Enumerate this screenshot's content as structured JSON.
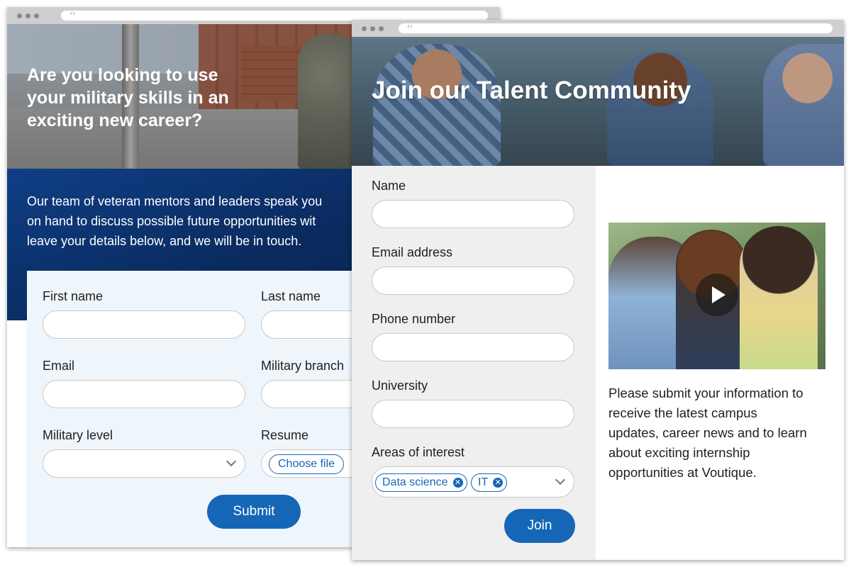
{
  "military_page": {
    "hero_heading_lines": [
      "Are you looking to use",
      "your military skills in an",
      "exciting new career?"
    ],
    "intro_lines": [
      "Our team of veteran mentors and leaders speak you",
      "on hand to discuss possible future opportunities wit",
      "leave your details below, and we will be in touch."
    ],
    "form": {
      "first_name_label": "First name",
      "last_name_label": "Last name",
      "email_label": "Email",
      "military_branch_label": "Military branch",
      "military_level_label": "Military level",
      "resume_label": "Resume",
      "choose_file_label": "Choose file",
      "submit_label": "Submit"
    }
  },
  "talent_page": {
    "hero_heading": "Join our Talent Community",
    "form": {
      "name_label": "Name",
      "email_label": "Email address",
      "phone_label": "Phone number",
      "university_label": "University",
      "interests_label": "Areas of interest",
      "interest_chips": [
        "Data science",
        "IT"
      ],
      "join_label": "Join"
    },
    "description_lines": [
      "Please submit your information to",
      "receive the latest campus",
      "updates, career news and to learn",
      "about exciting internship",
      "opportunities at Voutique."
    ]
  },
  "colors": {
    "accent_blue": "#1666b8",
    "navy_band": "#0a2a5e",
    "form_bg_light_blue": "#eef5fb",
    "form_bg_gray": "#efefef"
  },
  "icons": [
    "chevron-down-icon",
    "play-icon",
    "remove-chip-icon",
    "browser-dots-icon",
    "code-brackets-icon"
  ]
}
